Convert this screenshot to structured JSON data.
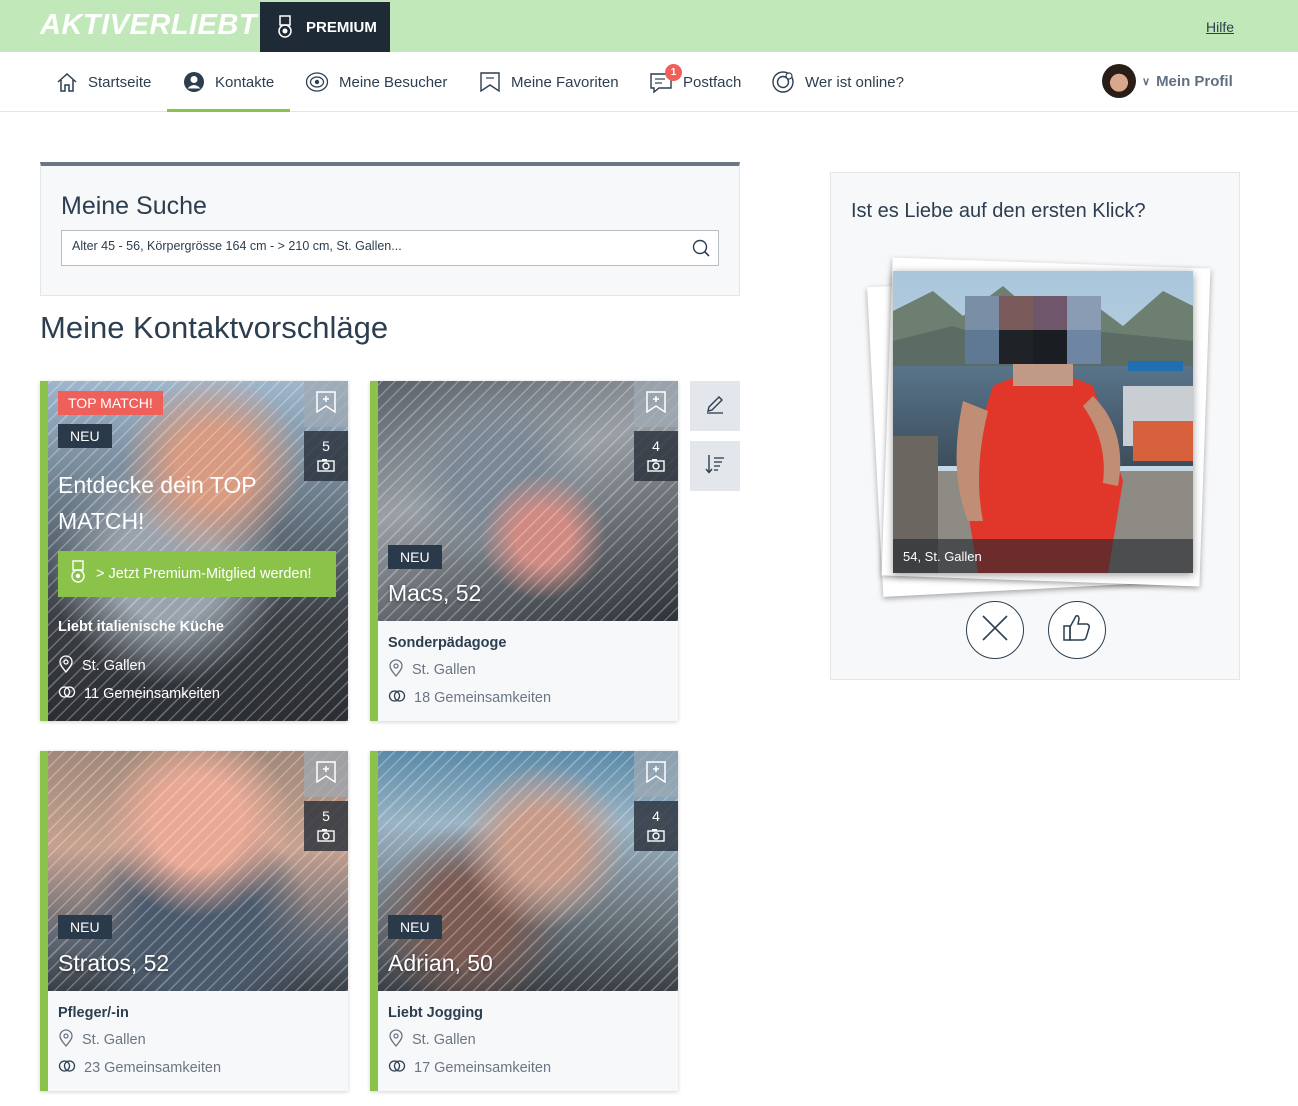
{
  "header": {
    "logo_text": "AKTIVERLIEBT",
    "premium_label": "PREMIUM",
    "help_label": "Hilfe"
  },
  "nav": {
    "items": [
      {
        "label": "Startseite",
        "icon": "home-icon"
      },
      {
        "label": "Kontakte",
        "icon": "contact-icon",
        "active": true
      },
      {
        "label": "Meine Besucher",
        "icon": "eye-icon"
      },
      {
        "label": "Meine Favoriten",
        "icon": "bookmark-icon"
      },
      {
        "label": "Postfach",
        "icon": "message-icon",
        "badge": "1"
      },
      {
        "label": "Wer ist online?",
        "icon": "online-icon"
      }
    ],
    "profile_label": "Mein Profil"
  },
  "search": {
    "title": "Meine Suche",
    "value": "Alter 45 - 56, Körpergrösse 164 cm - > 210 cm, St. Gallen..."
  },
  "section_title": "Meine Kontaktvorschläge",
  "top_match": {
    "badge": "TOP MATCH!",
    "new_label": "NEU",
    "headline": "Entdecke dein TOP MATCH!",
    "button_label": "> Jetzt Premium-Mitglied werden!",
    "photo_count": "5",
    "tagline": "Liebt italienische Küche",
    "location": "St. Gallen",
    "common": "11 Gemeinsamkeiten"
  },
  "cards": [
    {
      "name": "Macs, 52",
      "new_label": "NEU",
      "photo_count": "4",
      "tagline": "Sonderpädagoge",
      "location": "St. Gallen",
      "common": "18 Gemeinsamkeiten"
    },
    {
      "name": "Stratos, 52",
      "new_label": "NEU",
      "photo_count": "5",
      "tagline": "Pfleger/-in",
      "location": "St. Gallen",
      "common": "23 Gemeinsamkeiten"
    },
    {
      "name": "Adrian, 50",
      "new_label": "NEU",
      "photo_count": "4",
      "tagline": "Liebt Jogging",
      "location": "St. Gallen",
      "common": "17 Gemeinsamkeiten"
    }
  ],
  "quick_match": {
    "title": "Ist es Liebe auf den ersten Klick?",
    "caption": "54, St. Gallen"
  },
  "colors": {
    "accent_green": "#8bc34a",
    "header_green": "#c0e8b8",
    "dark": "#2b3a4a",
    "top_match_red": "#f0605a"
  }
}
